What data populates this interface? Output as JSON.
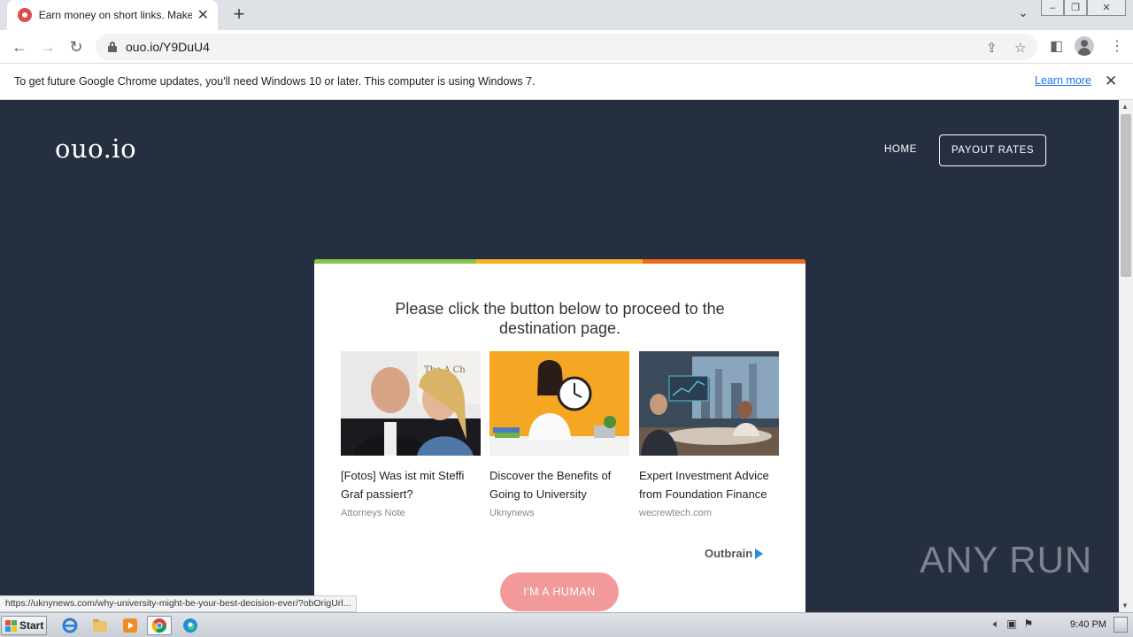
{
  "browser": {
    "tab_title": "Earn money on short links. Make sho",
    "tab_close": "✕",
    "new_tab": "+",
    "url": "ouo.io/Y9DuU4"
  },
  "infobar": {
    "message": "To get future Google Chrome updates, you'll need Windows 10 or later. This computer is using Windows 7.",
    "learn_more": "Learn more",
    "close": "✕"
  },
  "site": {
    "logo": "ouo.io",
    "nav": {
      "home": "HOME",
      "payout": "PAYOUT RATES"
    }
  },
  "card": {
    "headline": "Please click the button below to proceed to the destination page.",
    "stripe_colors": [
      "#8bc34a",
      "#f7b21e",
      "#f06a1d"
    ],
    "ads": [
      {
        "title": "[Fotos] Was ist mit Steffi Graf passiert?",
        "source": "Attorneys Note",
        "image_text": "The A Ch"
      },
      {
        "title": "Discover the Benefits of Going to University",
        "source": "Uknynews"
      },
      {
        "title": "Expert Investment Advice from Foundation Finance",
        "source": "wecrewtech.com"
      }
    ],
    "outbrain_label": "Outbrain",
    "button": "I'M A HUMAN",
    "button_color": "#f29a9a"
  },
  "status_url": "https://uknynews.com/why-university-might-be-your-best-decision-ever/?obOrigUrl...",
  "watermark": "ANY RUN",
  "taskbar": {
    "start": "Start",
    "clock": "9:40 PM"
  },
  "colors": {
    "page_bg": "#262f40",
    "accent_link": "#1a73e8"
  }
}
